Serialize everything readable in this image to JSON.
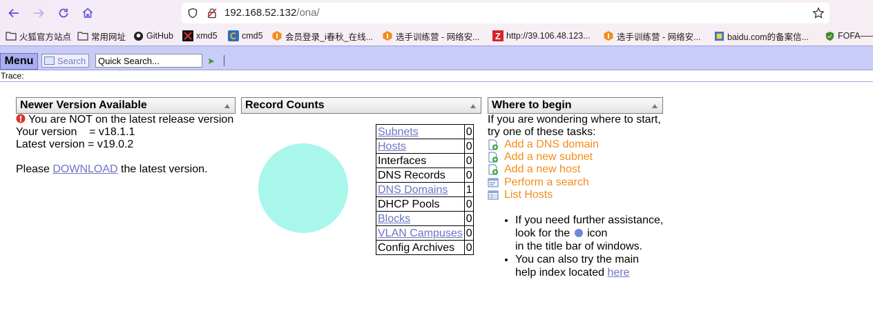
{
  "browser": {
    "url_host": "192.168.52.132",
    "url_path": "/ona/",
    "bookmarks": [
      {
        "label": "火狐官方站点",
        "icon": "folder-icon"
      },
      {
        "label": "常用网址",
        "icon": "folder-icon"
      },
      {
        "label": "GitHub",
        "icon": "github-icon"
      },
      {
        "label": "xmd5",
        "icon": "xmd5-icon"
      },
      {
        "label": "cmd5",
        "icon": "cmd5-icon"
      },
      {
        "label": "会员登录_i春秋_在线...",
        "icon": "ichunqiu-icon"
      },
      {
        "label": "选手训练营 - 网络安...",
        "icon": "ichunqiu-icon"
      },
      {
        "label": "http://39.106.48.123...",
        "icon": "z-icon"
      },
      {
        "label": "选手训练营 - 网络安...",
        "icon": "ichunqiu-icon"
      },
      {
        "label": "baidu.com的备案信...",
        "icon": "site-icon"
      },
      {
        "label": "FOFA——",
        "icon": "fofa-icon"
      }
    ]
  },
  "menubar": {
    "menu_label": "Menu",
    "search_label": "Search",
    "quick_search_value": "Quick Search...",
    "trace_label": "Trace:"
  },
  "version_panel": {
    "title": "Newer Version Available",
    "warning": "You are NOT on the latest release version",
    "your_version": "Your version    = v18.1.1",
    "latest_version": "Latest version = v19.0.2",
    "download_prefix": "Please ",
    "download_link": "DOWNLOAD",
    "download_suffix": " the latest version."
  },
  "record_panel": {
    "title": "Record Counts",
    "pie_color": "#a8f7ea",
    "rows": [
      {
        "label": "Subnets",
        "count": "0",
        "link": true
      },
      {
        "label": "Hosts",
        "count": "0",
        "link": true
      },
      {
        "label": "Interfaces",
        "count": "0",
        "link": false
      },
      {
        "label": "DNS Records",
        "count": "0",
        "link": false
      },
      {
        "label": "DNS Domains",
        "count": "1",
        "link": true
      },
      {
        "label": "DHCP Pools",
        "count": "0",
        "link": false
      },
      {
        "label": "Blocks",
        "count": "0",
        "link": true
      },
      {
        "label": "VLAN Campuses",
        "count": "0",
        "link": true
      },
      {
        "label": "Config Archives",
        "count": "0",
        "link": false
      }
    ]
  },
  "begin_panel": {
    "title": "Where to begin",
    "intro_1": "If you are wondering where to start,",
    "intro_2": "try one of these tasks:",
    "tasks": [
      {
        "label": "Add a DNS domain",
        "icon": "add-page-icon"
      },
      {
        "label": "Add a new subnet",
        "icon": "add-page-icon"
      },
      {
        "label": "Add a new host",
        "icon": "add-page-icon"
      },
      {
        "label": "Perform a search",
        "icon": "search-page-icon"
      },
      {
        "label": "List Hosts",
        "icon": "table-icon"
      }
    ],
    "help_1a": "If you need further assistance,",
    "help_1b": "look for the",
    "help_1c": "icon",
    "help_1d": "in the title bar of windows.",
    "help_2a": "You can also try the main",
    "help_2b": "help index located ",
    "help_2_link": "here"
  }
}
